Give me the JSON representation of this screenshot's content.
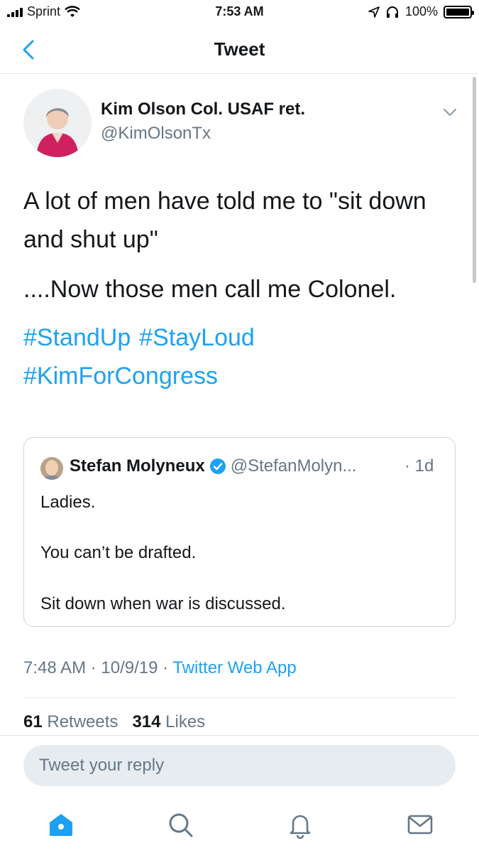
{
  "status_bar": {
    "carrier": "Sprint",
    "time": "7:53 AM",
    "battery": "100%"
  },
  "nav": {
    "title": "Tweet",
    "back_icon": "chevron-left-icon"
  },
  "tweet": {
    "author_name": "Kim Olson Col. USAF ret.",
    "author_handle": "@KimOlsonTx",
    "text_1": "A lot of men have told me to \"sit down and shut up\"",
    "text_2": "....Now those men call me Colonel.",
    "hashtags": [
      "#StandUp",
      "#StayLoud",
      "#KimForCongress"
    ],
    "timestamp": "7:48 AM · 10/9/19 · ",
    "source": "Twitter Web App",
    "retweets_count": "61",
    "retweets_label": "Retweets",
    "likes_count": "314",
    "likes_label": "Likes"
  },
  "quote": {
    "name": "Stefan Molyneux",
    "handle": "@StefanMolyn...",
    "time": "· 1d",
    "line_1": "Ladies.",
    "line_2": "You can’t be drafted.",
    "line_3": "Sit down when war is discussed."
  },
  "reply": {
    "placeholder": "Tweet your reply"
  },
  "tabs": [
    "home-icon",
    "search-icon",
    "notifications-icon",
    "messages-icon"
  ],
  "colors": {
    "accent": "#1da1f2",
    "secondary_text": "#657786",
    "border": "#e1e8ed",
    "reply_bg": "#e6ecf0"
  }
}
